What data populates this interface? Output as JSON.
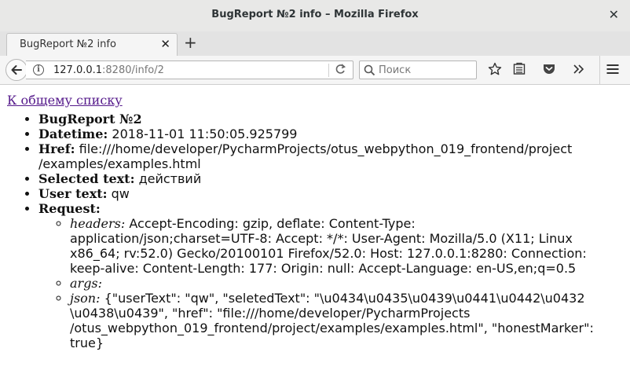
{
  "window": {
    "title": "BugReport №2 info – Mozilla Firefox"
  },
  "tabs": [
    {
      "label": "BugReport №2 info",
      "active": true
    }
  ],
  "navbar": {
    "url_host": "127.0.0.1",
    "url_rest": ":8280/info/2",
    "search_placeholder": "Поиск"
  },
  "page": {
    "back_link": "К общему списку",
    "heading": "BugReport №2",
    "fields": {
      "datetime_label": "Datetime:",
      "datetime_value": "2018-11-01 11:50:05.925799",
      "href_label": "Href:",
      "href_value_1": "file:///home/developer/PycharmProjects/otus_webpython_019_frontend/project",
      "href_value_2": "/examples/examples.html",
      "selected_label": "Selected text:",
      "selected_value": "действий",
      "user_label": "User text:",
      "user_value": "qw",
      "request_label": "Request:"
    },
    "request": {
      "headers_label": "headers:",
      "headers_value_1": "Accept-Encoding: gzip, deflate: Content-Type:",
      "headers_value_2": "application/json;charset=UTF-8: Accept: */*: User-Agent: Mozilla/5.0 (X11; Linux",
      "headers_value_3": "x86_64; rv:52.0) Gecko/20100101 Firefox/52.0: Host: 127.0.0.1:8280: Connection:",
      "headers_value_4": "keep-alive: Content-Length: 177: Origin: null: Accept-Language: en-US,en;q=0.5",
      "args_label": "args:",
      "json_label": "json:",
      "json_value_1": "{\"userText\": \"qw\", \"seletedText\": \"\\u0434\\u0435\\u0439\\u0441\\u0442\\u0432",
      "json_value_2": "\\u0438\\u0439\", \"href\": \"file:///home/developer/PycharmProjects",
      "json_value_3": "/otus_webpython_019_frontend/project/examples/examples.html\", \"honestMarker\":",
      "json_value_4": "true}"
    }
  }
}
